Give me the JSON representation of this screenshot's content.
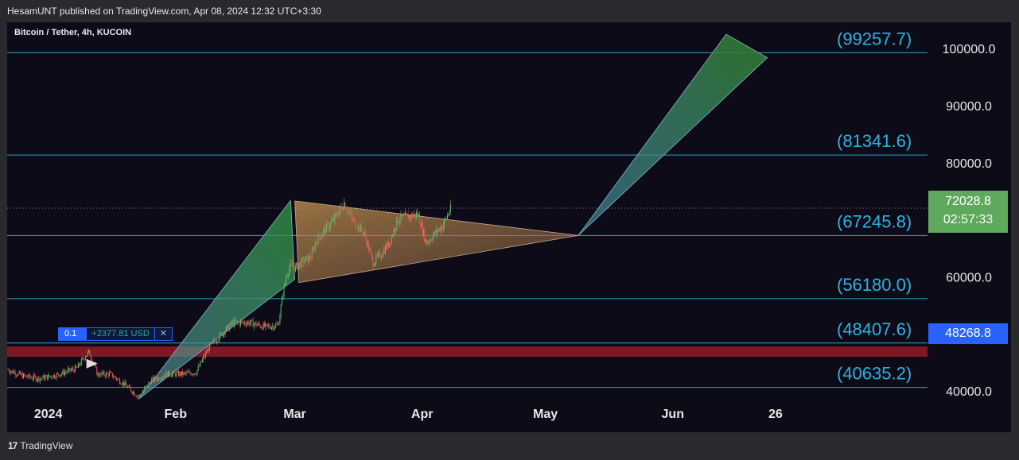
{
  "header": {
    "publisher_text": "HesamUNT published on TradingView.com, Apr 08, 2024 12:32 UTC+3:30"
  },
  "symbol": {
    "title": "Bitcoin / Tether, 4h, KUCOIN"
  },
  "position_tool": {
    "quantity": "0.1",
    "pnl": "+2377.81 USD",
    "close_label": "✕"
  },
  "last_price": {
    "price": "72028.8",
    "countdown": "02:57:33"
  },
  "level_tag": {
    "price": "48268.8"
  },
  "footer": {
    "brand": "TradingView",
    "logo_glyph": "17"
  },
  "colors": {
    "background": "#0d0b18",
    "level_line": "#2fa3c4",
    "level_label": "#2ab4e0",
    "up_candle": "#66bb6a",
    "down_candle": "#ef5350",
    "resistance_zone": "#8b1a24",
    "last_price_tag": "#5fa85c",
    "level_tag": "#2962ff"
  },
  "chart_data": {
    "type": "candlestick",
    "interval": "4h",
    "y_axis": {
      "ylim": [
        37800,
        104600
      ],
      "ticks": [
        40000,
        50000,
        60000,
        70000,
        80000,
        90000,
        100000
      ],
      "tick_labels": [
        "40000.0",
        "50000.0",
        "60000.0",
        "",
        "80000.0",
        "90000.0",
        "100000.0"
      ],
      "side": "right"
    },
    "x_axis": {
      "labels": [
        "2024",
        "Feb",
        "Mar",
        "Apr",
        "May",
        "Jun",
        "26"
      ],
      "label_dates": [
        "2024-01-01",
        "2024-02-01",
        "2024-03-01",
        "2024-04-01",
        "2024-05-01",
        "2024-06-01",
        "2024-06-26"
      ],
      "xlim": [
        "2023-12-22",
        "2024-08-02"
      ]
    },
    "horizontal_levels": [
      {
        "value": 99257.7,
        "label": "(99257.7)"
      },
      {
        "value": 81341.6,
        "label": "(81341.6)"
      },
      {
        "value": 67245.8,
        "label": "(67245.8)"
      },
      {
        "value": 56180.0,
        "label": "(56180.0)"
      },
      {
        "value": 48407.6,
        "label": "(48407.6)"
      },
      {
        "value": 40635.2,
        "label": "(40635.2)"
      }
    ],
    "zone": {
      "from": 46000,
      "to": 47800
    },
    "last_price": 72028.8,
    "triangle": [
      {
        "date": "2024-03-01",
        "price": 73300
      },
      {
        "date": "2024-03-02",
        "price": 59000
      },
      {
        "date": "2024-05-09",
        "price": 67245.8
      }
    ],
    "fan_up": [
      {
        "date": "2024-01-23",
        "price": 38600
      },
      {
        "date": "2024-02-29",
        "price": 73400
      },
      {
        "date": "2024-03-01",
        "price": 59600
      }
    ],
    "fan_target": [
      {
        "date": "2024-05-09",
        "price": 67245.8
      },
      {
        "date": "2024-06-14",
        "price": 102500
      },
      {
        "date": "2024-06-24",
        "price": 98400
      }
    ],
    "price_path": [
      {
        "date": "2023-12-22",
        "price": 43800
      },
      {
        "date": "2023-12-26",
        "price": 42600
      },
      {
        "date": "2023-12-30",
        "price": 42200
      },
      {
        "date": "2024-01-03",
        "price": 42800
      },
      {
        "date": "2024-01-08",
        "price": 44000
      },
      {
        "date": "2024-01-10",
        "price": 46200
      },
      {
        "date": "2024-01-11",
        "price": 46800
      },
      {
        "date": "2024-01-13",
        "price": 42900
      },
      {
        "date": "2024-01-16",
        "price": 43000
      },
      {
        "date": "2024-01-19",
        "price": 41500
      },
      {
        "date": "2024-01-23",
        "price": 39000
      },
      {
        "date": "2024-01-26",
        "price": 41800
      },
      {
        "date": "2024-01-30",
        "price": 43000
      },
      {
        "date": "2024-02-03",
        "price": 43000
      },
      {
        "date": "2024-02-06",
        "price": 43300
      },
      {
        "date": "2024-02-09",
        "price": 47500
      },
      {
        "date": "2024-02-12",
        "price": 49900
      },
      {
        "date": "2024-02-15",
        "price": 52000
      },
      {
        "date": "2024-02-19",
        "price": 52000
      },
      {
        "date": "2024-02-23",
        "price": 51200
      },
      {
        "date": "2024-02-26",
        "price": 51600
      },
      {
        "date": "2024-02-27",
        "price": 56500
      },
      {
        "date": "2024-02-28",
        "price": 60500
      },
      {
        "date": "2024-02-29",
        "price": 62000
      },
      {
        "date": "2024-03-01",
        "price": 61500
      },
      {
        "date": "2024-03-03",
        "price": 62700
      },
      {
        "date": "2024-03-05",
        "price": 63500
      },
      {
        "date": "2024-03-06",
        "price": 66000
      },
      {
        "date": "2024-03-08",
        "price": 68000
      },
      {
        "date": "2024-03-10",
        "price": 69500
      },
      {
        "date": "2024-03-13",
        "price": 73000
      },
      {
        "date": "2024-03-15",
        "price": 70000
      },
      {
        "date": "2024-03-18",
        "price": 67500
      },
      {
        "date": "2024-03-20",
        "price": 62500
      },
      {
        "date": "2024-03-22",
        "price": 64000
      },
      {
        "date": "2024-03-24",
        "price": 66000
      },
      {
        "date": "2024-03-26",
        "price": 70000
      },
      {
        "date": "2024-03-28",
        "price": 70500
      },
      {
        "date": "2024-03-31",
        "price": 71000
      },
      {
        "date": "2024-04-02",
        "price": 66000
      },
      {
        "date": "2024-04-04",
        "price": 67500
      },
      {
        "date": "2024-04-06",
        "price": 69000
      },
      {
        "date": "2024-04-08",
        "price": 72028.8
      }
    ]
  }
}
